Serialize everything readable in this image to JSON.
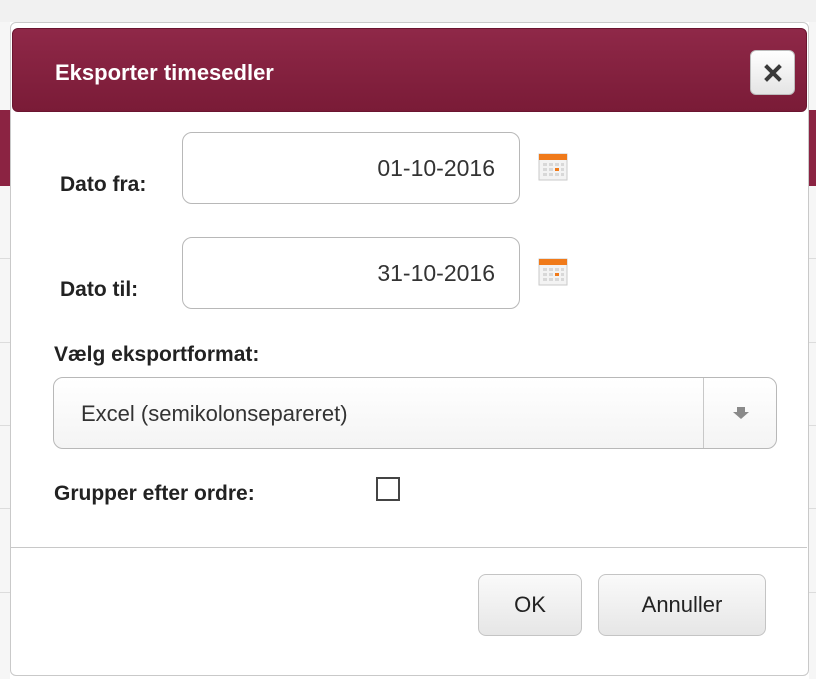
{
  "dialog": {
    "title": "Eksporter timesedler",
    "close_icon": "close-icon"
  },
  "form": {
    "date_from": {
      "label": "Dato fra:",
      "value": "01-10-2016"
    },
    "date_to": {
      "label": "Dato til:",
      "value": "31-10-2016"
    },
    "calendar_icon": "calendar-icon",
    "format": {
      "label": "Vælg eksportformat:",
      "selected": "Excel (semikolonsepareret)"
    },
    "group_by_order": {
      "label": "Grupper efter ordre:",
      "checked": false
    }
  },
  "buttons": {
    "ok": "OK",
    "cancel": "Annuller"
  },
  "colors": {
    "titlebar": "#7f1f3c",
    "accent": "#f07a1a"
  }
}
